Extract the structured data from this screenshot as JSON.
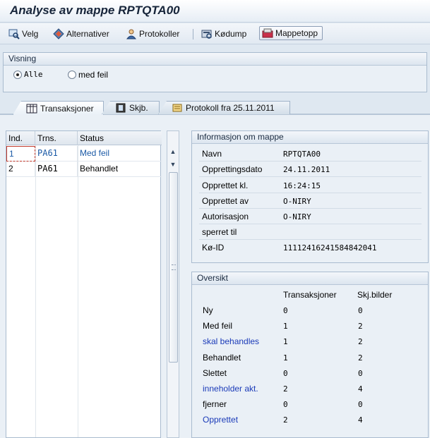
{
  "window": {
    "title": "Analyse av mappe RPTQTA00"
  },
  "toolbar": {
    "velg": "Velg",
    "alternativer": "Alternativer",
    "protokoller": "Protokoller",
    "kodump": "Kødump",
    "mappetopp": "Mappetopp"
  },
  "visning": {
    "title": "Visning",
    "options": [
      {
        "label": "Alle",
        "selected": true
      },
      {
        "label": "med feil",
        "selected": false
      }
    ]
  },
  "tabs": [
    {
      "label": "Transaksjoner",
      "icon": "table-icon",
      "active": true
    },
    {
      "label": "Skjb.",
      "icon": "film-icon",
      "active": false
    },
    {
      "label": "Protokoll fra 25.11.2011",
      "icon": "scroll-icon",
      "active": false
    }
  ],
  "transactions": {
    "headers": [
      "Ind.",
      "Trns.",
      "Status"
    ],
    "rows": [
      {
        "ind": "1",
        "trns": "PA61",
        "status": "Med feil"
      },
      {
        "ind": "2",
        "trns": "PA61",
        "status": "Behandlet"
      }
    ]
  },
  "info": {
    "title": "Informasjon om mappe",
    "fields": [
      {
        "label": "Navn",
        "value": "RPTQTA00"
      },
      {
        "label": "Opprettingsdato",
        "value": "24.11.2011"
      },
      {
        "label": "Opprettet kl.",
        "value": "16:24:15"
      },
      {
        "label": "Opprettet av",
        "value": "O-NIRY"
      },
      {
        "label": "Autorisasjon",
        "value": "O-NIRY"
      },
      {
        "label": "sperret til",
        "value": ""
      },
      {
        "label": "Kø-ID",
        "value": "11112416241584842041"
      }
    ]
  },
  "overview": {
    "title": "Oversikt",
    "col_headers": [
      "Transaksjoner",
      "Skj.bilder"
    ],
    "rows": [
      {
        "label": "Ny",
        "trans": "0",
        "skj": "0",
        "link": false
      },
      {
        "label": "Med feil",
        "trans": "1",
        "skj": "2",
        "link": false
      },
      {
        "label": "skal behandles",
        "trans": "1",
        "skj": "2",
        "link": true
      },
      {
        "label": "Behandlet",
        "trans": "1",
        "skj": "2",
        "link": false
      },
      {
        "label": "Slettet",
        "trans": "0",
        "skj": "0",
        "link": false
      },
      {
        "label": "inneholder akt.",
        "trans": "2",
        "skj": "4",
        "link": true
      },
      {
        "label": "fjerner",
        "trans": "0",
        "skj": "0",
        "link": false
      },
      {
        "label": "Opprettet",
        "trans": "2",
        "skj": "4",
        "link": true
      }
    ]
  }
}
